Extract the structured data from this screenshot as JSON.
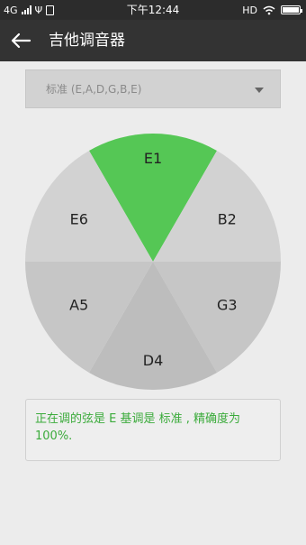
{
  "status_bar": {
    "network": "4G",
    "time": "下午12:44",
    "hd": "HD",
    "battery_level": 1.0,
    "icons": [
      "signal-icon",
      "usb-icon",
      "sim-icon",
      "wifi-icon",
      "battery-icon"
    ]
  },
  "app_bar": {
    "title": "吉他调音器",
    "back_icon": "arrow-left-icon"
  },
  "tuning": {
    "selected": "标准 (E,A,D,G,B,E)"
  },
  "wheel": {
    "active_color": "#55c755",
    "inactive_colors": [
      "#d2d2d2",
      "#c6c6c6",
      "#bdbdbd"
    ],
    "strings": [
      {
        "label": "E1",
        "active": true
      },
      {
        "label": "B2",
        "active": false
      },
      {
        "label": "G3",
        "active": false
      },
      {
        "label": "D4",
        "active": false
      },
      {
        "label": "A5",
        "active": false
      },
      {
        "label": "E6",
        "active": false
      }
    ]
  },
  "status_message": "正在调的弦是 E 基调是 标准 , 精确度为 100%."
}
